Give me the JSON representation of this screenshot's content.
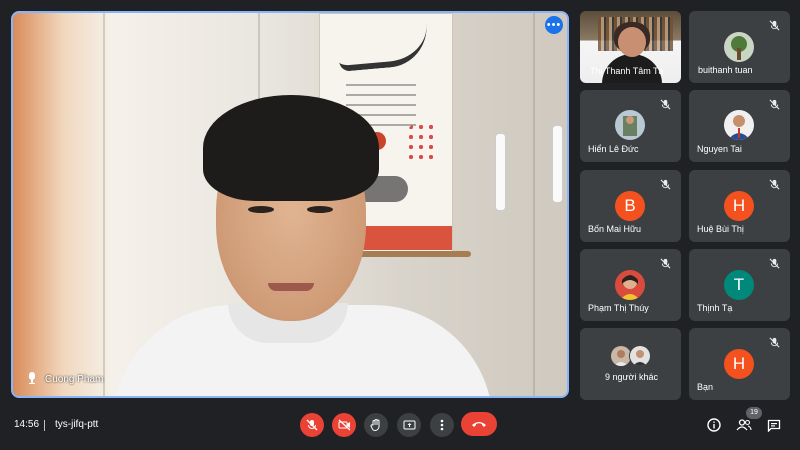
{
  "main_speaker": {
    "name": "Cuong Pham"
  },
  "tiles": [
    {
      "name": "Thị Thanh Tâm Tạ",
      "avatar": "photo"
    },
    {
      "name": "buithanh tuan",
      "avatar": "photo-plant"
    },
    {
      "name": "Hiển Lê Đức",
      "avatar": "photo"
    },
    {
      "name": "Nguyen Tai",
      "avatar": "photo"
    },
    {
      "name": "Bốn Mai Hữu",
      "avatar_letter": "B",
      "color": "#f4511e"
    },
    {
      "name": "Huệ Bùi Thị",
      "avatar_letter": "H",
      "color": "#f4511e"
    },
    {
      "name": "Phạm Thị Thúy",
      "avatar": "photo"
    },
    {
      "name": "Thịnh Tạ",
      "avatar_letter": "T",
      "color": "#00897b"
    },
    {
      "name": "9 người khác",
      "avatar": "group"
    },
    {
      "name": "Bạn",
      "avatar_letter": "H",
      "color": "#f4511e"
    }
  ],
  "bottom_bar": {
    "time": "14:56",
    "meeting_code": "tys-jifq-ptt",
    "participants_badge": "19"
  },
  "colors": {
    "accent": "#8ab4f8",
    "red": "#ea4335",
    "gray_btn": "#3c4043",
    "tile_bg": "#3c4043"
  },
  "icons": {
    "mic_off": "mic-off-icon",
    "camera_off": "camera-off-icon",
    "raise_hand": "hand-icon",
    "present": "present-icon",
    "more": "more-vert-icon",
    "leave": "call-end-icon",
    "info": "info-icon",
    "people": "people-icon",
    "chat": "chat-icon"
  }
}
